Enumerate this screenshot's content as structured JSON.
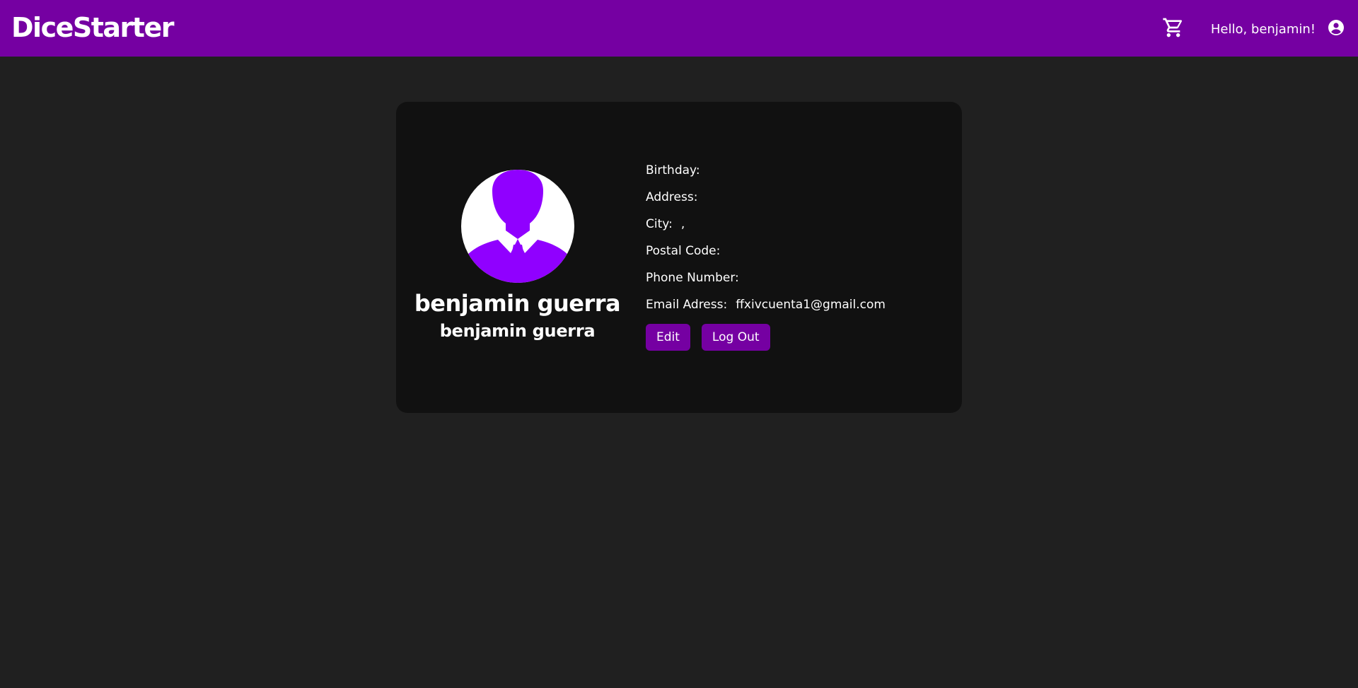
{
  "navbar": {
    "brand": "DiceStarter",
    "greeting": "Hello, benjamin!",
    "cart_icon": "shopping-cart-icon",
    "user_icon": "account-circle-icon"
  },
  "profile": {
    "full_name": "benjamin guerra",
    "username": "benjamin guerra",
    "avatar_icon": "person-silhouette-icon",
    "avatar_color": "#9000ff"
  },
  "details": {
    "birthday_label": "Birthday:",
    "birthday_value": "",
    "address_label": "Address:",
    "address_value": "",
    "city_label": "City:",
    "city_value": ",",
    "postal_label": "Postal Code:",
    "postal_value": "",
    "phone_label": "Phone Number:",
    "phone_value": "",
    "email_label": "Email Adress:",
    "email_value": "ffxivcuenta1@gmail.com"
  },
  "actions": {
    "edit": "Edit",
    "logout": "Log Out"
  },
  "colors": {
    "accent": "#7500a2",
    "page_bg": "#202020",
    "card_bg": "#111111"
  }
}
